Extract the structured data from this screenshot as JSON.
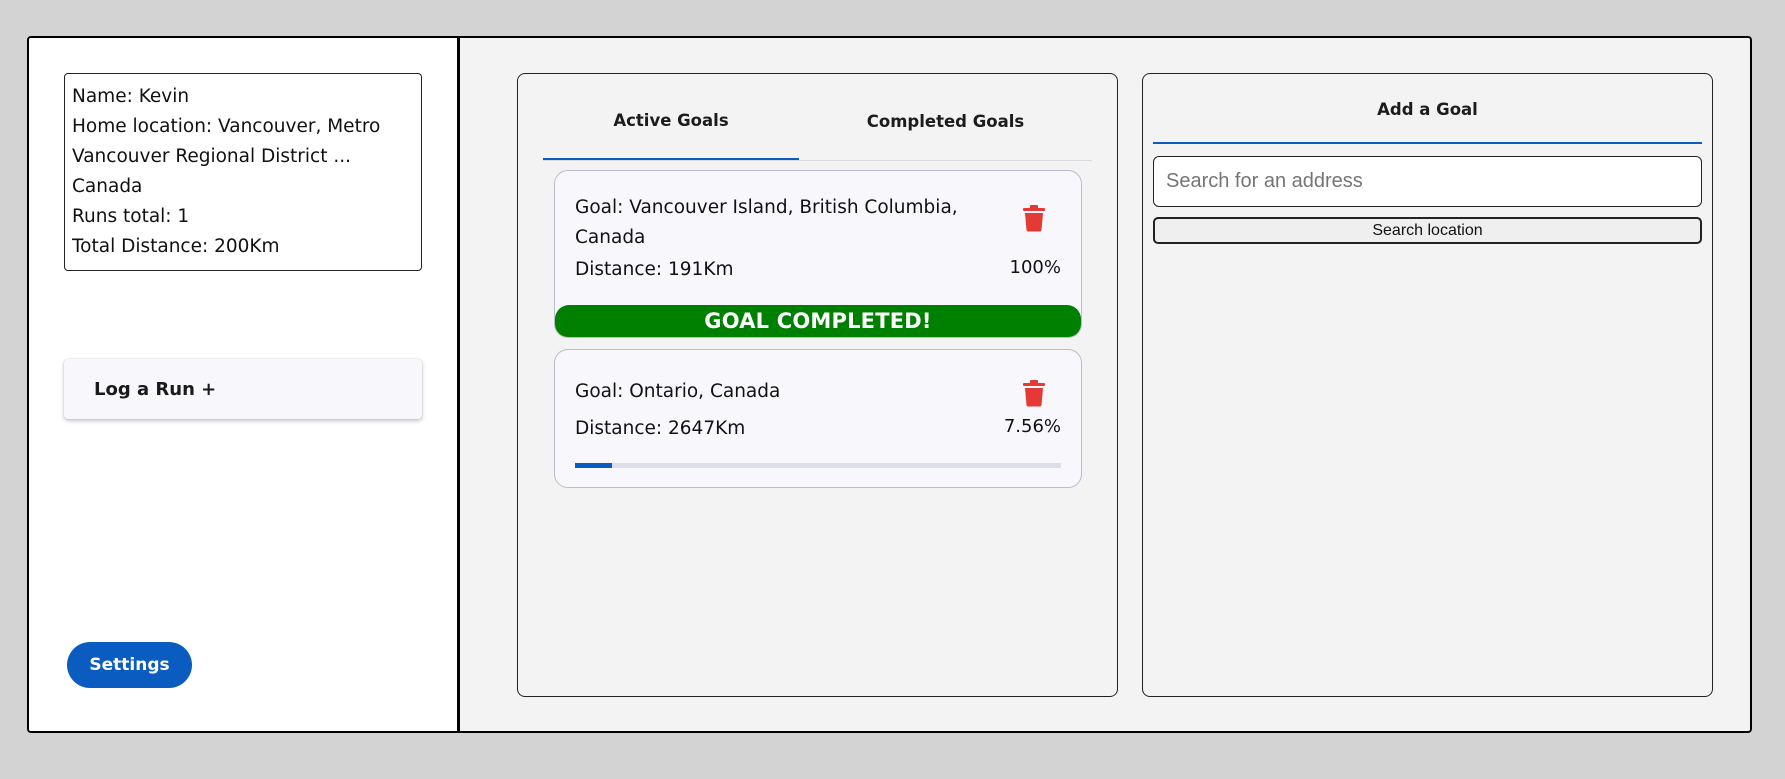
{
  "profile": {
    "lines": [
      "Name: Kevin",
      "Home location: Vancouver, Metro",
      "Vancouver Regional District ...",
      "Canada",
      "Runs total: 1",
      "Total Distance: 200Km"
    ]
  },
  "sidebar": {
    "log_run_label": "Log a Run +",
    "settings_label": "Settings"
  },
  "goals_panel": {
    "tabs": [
      {
        "label": "Active Goals",
        "active": true
      },
      {
        "label": "Completed Goals",
        "active": false
      }
    ],
    "goals": [
      {
        "title": "Goal: Vancouver Island, British Columbia, Canada",
        "distance": "Distance: 191Km",
        "percent": "100%",
        "progress": 1.0,
        "completed_label": "GOAL COMPLETED!"
      },
      {
        "title": "Goal: Ontario, Canada",
        "distance": "Distance: 2647Km",
        "percent": "7.56%",
        "progress": 0.0756
      }
    ]
  },
  "add_goal_panel": {
    "title": "Add a Goal",
    "search_placeholder": "Search for an address",
    "search_value": "",
    "search_button_label": "Search location"
  },
  "colors": {
    "accent": "#0b5cc0",
    "completed": "#008000",
    "delete_icon": "#e53935"
  },
  "icons": {
    "delete": "trash-icon"
  }
}
